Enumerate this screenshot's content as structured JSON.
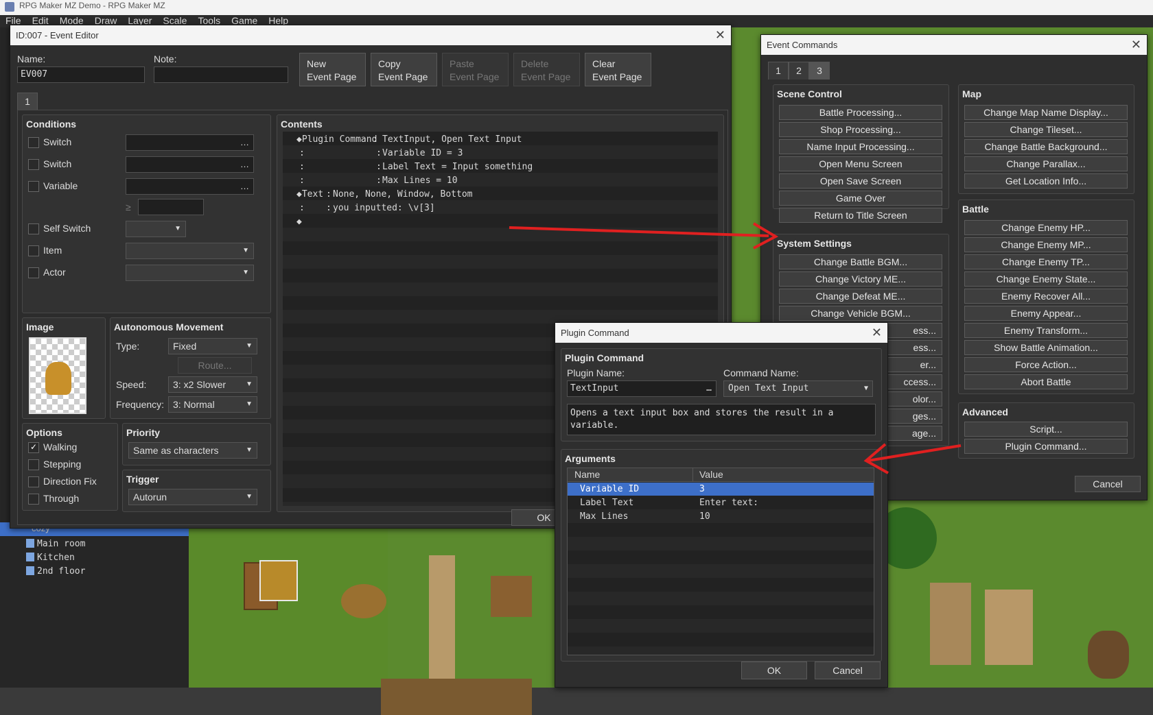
{
  "app": {
    "title": "RPG Maker MZ Demo - RPG Maker MZ",
    "menu": [
      "File",
      "Edit",
      "Mode",
      "Draw",
      "Layer",
      "Scale",
      "Tools",
      "Game",
      "Help"
    ]
  },
  "map_tree": {
    "items": [
      "cozy",
      "Main room",
      "Kitchen",
      "2nd floor"
    ]
  },
  "event_editor": {
    "title": "ID:007 - Event Editor",
    "name_label": "Name:",
    "name_value": "EV007",
    "note_label": "Note:",
    "note_value": "",
    "buttons": {
      "new": [
        "New",
        "Event Page"
      ],
      "copy": [
        "Copy",
        "Event Page"
      ],
      "paste": [
        "Paste",
        "Event Page"
      ],
      "delete": [
        "Delete",
        "Event Page"
      ],
      "clear": [
        "Clear",
        "Event Page"
      ]
    },
    "page_tab": "1",
    "conditions": {
      "title": "Conditions",
      "switch1": "Switch",
      "switch2": "Switch",
      "variable": "Variable",
      "self_switch": "Self Switch",
      "item": "Item",
      "actor": "Actor",
      "ge": "≥",
      "dots": "…"
    },
    "image": {
      "title": "Image"
    },
    "movement": {
      "title": "Autonomous Movement",
      "type_label": "Type:",
      "type_value": "Fixed",
      "route": "Route...",
      "speed_label": "Speed:",
      "speed_value": "3: x2 Slower",
      "freq_label": "Frequency:",
      "freq_value": "3: Normal"
    },
    "options": {
      "title": "Options",
      "walking": "Walking",
      "stepping": "Stepping",
      "direction_fix": "Direction Fix",
      "through": "Through",
      "check": "✓"
    },
    "priority": {
      "title": "Priority",
      "value": "Same as characters"
    },
    "trigger": {
      "title": "Trigger",
      "value": "Autorun"
    },
    "contents": {
      "title": "Contents",
      "lines": [
        {
          "head": "◆Plugin Command",
          "sep": ":",
          "body": "TextInput, Open Text Input"
        },
        {
          "head": ":",
          "sep": ":",
          "body": "Variable ID = 3"
        },
        {
          "head": ":",
          "sep": ":",
          "body": "Label Text = Input something"
        },
        {
          "head": ":",
          "sep": ":",
          "body": "Max Lines = 10"
        },
        {
          "head": "◆Text",
          "sep": ":",
          "body": "None, None, Window, Bottom"
        },
        {
          "head": ":",
          "sep": ":",
          "body": "you inputted: \\v[3]"
        },
        {
          "head": "◆",
          "sep": "",
          "body": ""
        }
      ]
    },
    "ok": "OK"
  },
  "event_commands": {
    "title": "Event Commands",
    "tabs": [
      "1",
      "2",
      "3"
    ],
    "scene_control": {
      "title": "Scene Control",
      "items": [
        "Battle Processing...",
        "Shop Processing...",
        "Name Input Processing...",
        "Open Menu Screen",
        "Open Save Screen",
        "Game Over",
        "Return to Title Screen"
      ]
    },
    "system_settings": {
      "title": "System Settings",
      "items": [
        "Change Battle BGM...",
        "Change Victory ME...",
        "Change Defeat ME...",
        "Change Vehicle BGM...",
        "ess...",
        "ess...",
        "er...",
        "ccess...",
        "olor...",
        "ges...",
        "age..."
      ]
    },
    "map": {
      "title": "Map",
      "items": [
        "Change Map Name Display...",
        "Change Tileset...",
        "Change Battle Background...",
        "Change Parallax...",
        "Get Location Info..."
      ]
    },
    "battle": {
      "title": "Battle",
      "items": [
        "Change Enemy HP...",
        "Change Enemy MP...",
        "Change Enemy TP...",
        "Change Enemy State...",
        "Enemy Recover All...",
        "Enemy Appear...",
        "Enemy Transform...",
        "Show Battle Animation...",
        "Force Action...",
        "Abort Battle"
      ]
    },
    "advanced": {
      "title": "Advanced",
      "items": [
        "Script...",
        "Plugin Command..."
      ]
    },
    "cancel": "Cancel"
  },
  "plugin_command": {
    "title": "Plugin Command",
    "group_title": "Plugin Command",
    "plugin_name_label": "Plugin Name:",
    "plugin_name": "TextInput",
    "command_name_label": "Command Name:",
    "command_name": "Open Text Input",
    "description": "Opens a text input box and stores the result in a variable.",
    "arguments_title": "Arguments",
    "col_name": "Name",
    "col_value": "Value",
    "rows": [
      {
        "name": "Variable ID",
        "value": "3"
      },
      {
        "name": "Label Text",
        "value": "Enter text:"
      },
      {
        "name": "Max Lines",
        "value": "10"
      }
    ],
    "ok": "OK",
    "cancel": "Cancel",
    "dots": "…"
  },
  "colors": {
    "accent": "#3d6fc8",
    "arrow": "#e02020"
  }
}
